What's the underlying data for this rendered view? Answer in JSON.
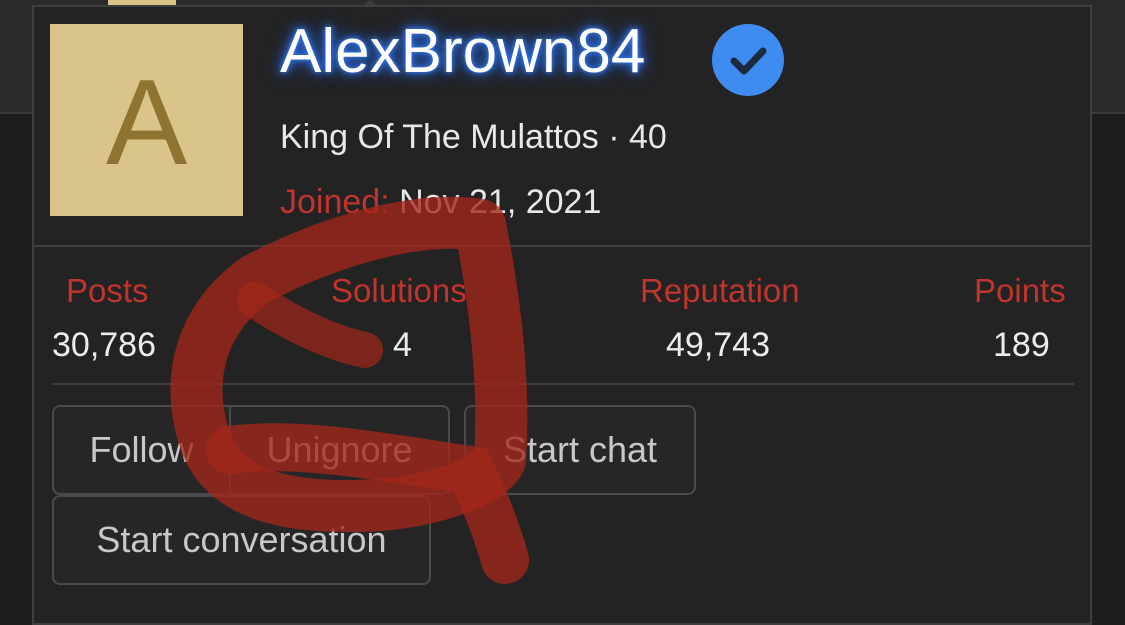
{
  "profile": {
    "avatar_letter": "A",
    "avatar_bg_color": "#d9c48a",
    "username": "AlexBrown84",
    "verified_icon": "check-badge-icon",
    "title": "King Of The Mulattos",
    "separator": "·",
    "level": "40",
    "joined_label": "Joined:",
    "joined_value": "Nov 21, 2021"
  },
  "stats": {
    "posts_label": "Posts",
    "posts_value": "30,786",
    "solutions_label": "Solutions",
    "solutions_value": "4",
    "reputation_label": "Reputation",
    "reputation_value": "49,743",
    "points_label": "Points",
    "points_value": "189"
  },
  "actions": {
    "follow_label": "Follow",
    "unignore_label": "Unignore",
    "start_chat_label": "Start chat",
    "start_conversation_label": "Start conversation"
  },
  "colors": {
    "accent_red": "#c0342b",
    "verified_blue": "#3f8cf0",
    "username_glow": "#2f7bff",
    "scribble": "#a3271a"
  }
}
